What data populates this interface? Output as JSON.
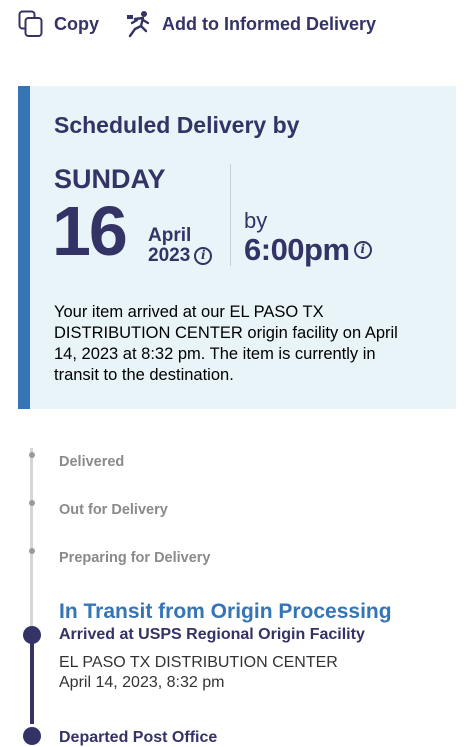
{
  "actions": {
    "copy_label": "Copy",
    "informed_delivery_label": "Add to Informed Delivery"
  },
  "scheduled": {
    "title": "Scheduled Delivery by",
    "weekday": "SUNDAY",
    "day": "16",
    "month": "April",
    "year": "2023",
    "by_label": "by",
    "time": "6:00pm",
    "message": "Your item arrived at our EL PASO TX DISTRIBUTION CENTER origin facility on April 14, 2023 at 8:32 pm. The item is currently in transit to the destination."
  },
  "timeline": {
    "steps": [
      {
        "label": "Delivered"
      },
      {
        "label": "Out for Delivery"
      },
      {
        "label": "Preparing for Delivery"
      }
    ],
    "current_status": "In Transit from Origin Processing",
    "events": [
      {
        "title": "Arrived at USPS Regional Origin Facility",
        "location": "EL PASO TX DISTRIBUTION CENTER",
        "datetime": "April 14, 2023, 8:32 pm"
      },
      {
        "title": "Departed Post Office"
      }
    ]
  },
  "colors": {
    "navy": "#333366",
    "accent_blue": "#3574b5",
    "card_bg": "#e8f4f8",
    "muted": "#8a8a8a"
  },
  "icons": {
    "copy": "copy-icon",
    "informed": "runner-icon",
    "info": "info-icon"
  }
}
